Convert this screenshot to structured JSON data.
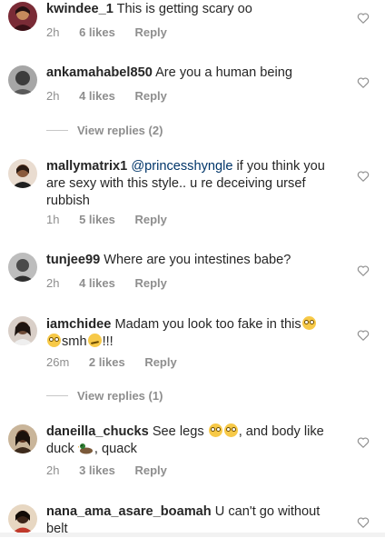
{
  "comments": [
    {
      "username": "kwindee_1",
      "text": "This is getting scary oo",
      "time": "2h",
      "likes": "6 likes",
      "reply": "Reply"
    },
    {
      "username": "ankamahabel850",
      "text": "Are you a human being",
      "time": "2h",
      "likes": "4 likes",
      "reply": "Reply",
      "view_replies": "View replies (2)"
    },
    {
      "username": "mallymatrix1",
      "mention": "@princesshyngle",
      "text": " if you think you are sexy with this style.. u re deceiving ursef rubbish",
      "time": "1h",
      "likes": "5 likes",
      "reply": "Reply"
    },
    {
      "username": "tunjee99",
      "text": "Where are you intestines babe?",
      "time": "2h",
      "likes": "4 likes",
      "reply": "Reply"
    },
    {
      "username": "iamchidee",
      "text_a": "Madam you look too fake in this",
      "text_b": "smh",
      "text_c": "!!!",
      "time": "26m",
      "likes": "2 likes",
      "reply": "Reply",
      "view_replies": "View replies (1)"
    },
    {
      "username": "daneilla_chucks",
      "text_a": "See legs",
      "text_b": ", and body like duck",
      "text_c": ", quack",
      "time": "2h",
      "likes": "3 likes",
      "reply": "Reply"
    },
    {
      "username": "nana_ama_asare_boamah",
      "text": "U can't go without belt"
    }
  ],
  "icons": {
    "like": "heart-outline-icon",
    "emoji_rolling": "face-with-rolling-eyes-emoji",
    "emoji_smirk": "unamused-face-emoji",
    "emoji_duck": "duck-emoji"
  },
  "colors": {
    "text": "#262626",
    "meta": "#8e8e8e",
    "mention": "#003569",
    "background": "#ffffff"
  }
}
